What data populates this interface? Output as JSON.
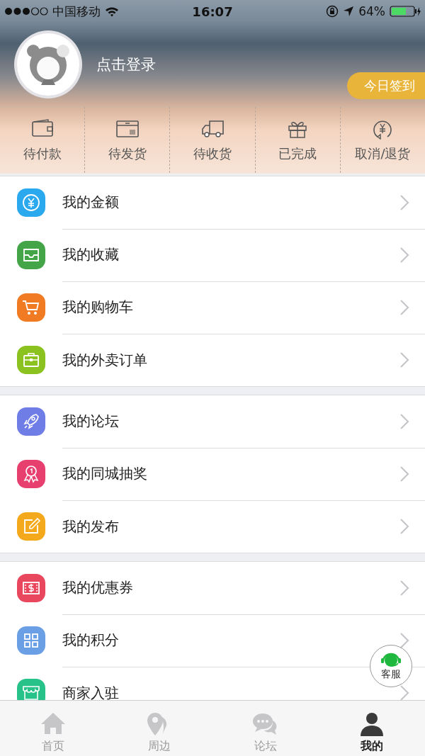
{
  "status_bar": {
    "carrier": "中国移动",
    "time": "16:07",
    "battery": "64%"
  },
  "profile": {
    "login": "点击登录",
    "sign_in": "今日签到"
  },
  "orders": [
    {
      "label": "待付款"
    },
    {
      "label": "待发货"
    },
    {
      "label": "待收货"
    },
    {
      "label": "已完成"
    },
    {
      "label": "取消/退货"
    }
  ],
  "menu_groups": [
    [
      {
        "label": "我的金额",
        "color": "#2aa9ef"
      },
      {
        "label": "我的收藏",
        "color": "#43a548"
      },
      {
        "label": "我的购物车",
        "color": "#f07b22"
      },
      {
        "label": "我的外卖订单",
        "color": "#8cc21f"
      }
    ],
    [
      {
        "label": "我的论坛",
        "color": "#6f7de6"
      },
      {
        "label": "我的同城抽奖",
        "color": "#e8406e"
      },
      {
        "label": "我的发布",
        "color": "#f4a91c"
      }
    ],
    [
      {
        "label": "我的优惠券",
        "color": "#e8475e"
      },
      {
        "label": "我的积分",
        "color": "#6a9fe6"
      },
      {
        "label": "商家入驻",
        "color": "#27c18a"
      }
    ]
  ],
  "service_button": "客服",
  "tabs": [
    {
      "label": "首页",
      "selected": false
    },
    {
      "label": "周边",
      "selected": false
    },
    {
      "label": "论坛",
      "selected": false
    },
    {
      "label": "我的",
      "selected": true
    }
  ]
}
